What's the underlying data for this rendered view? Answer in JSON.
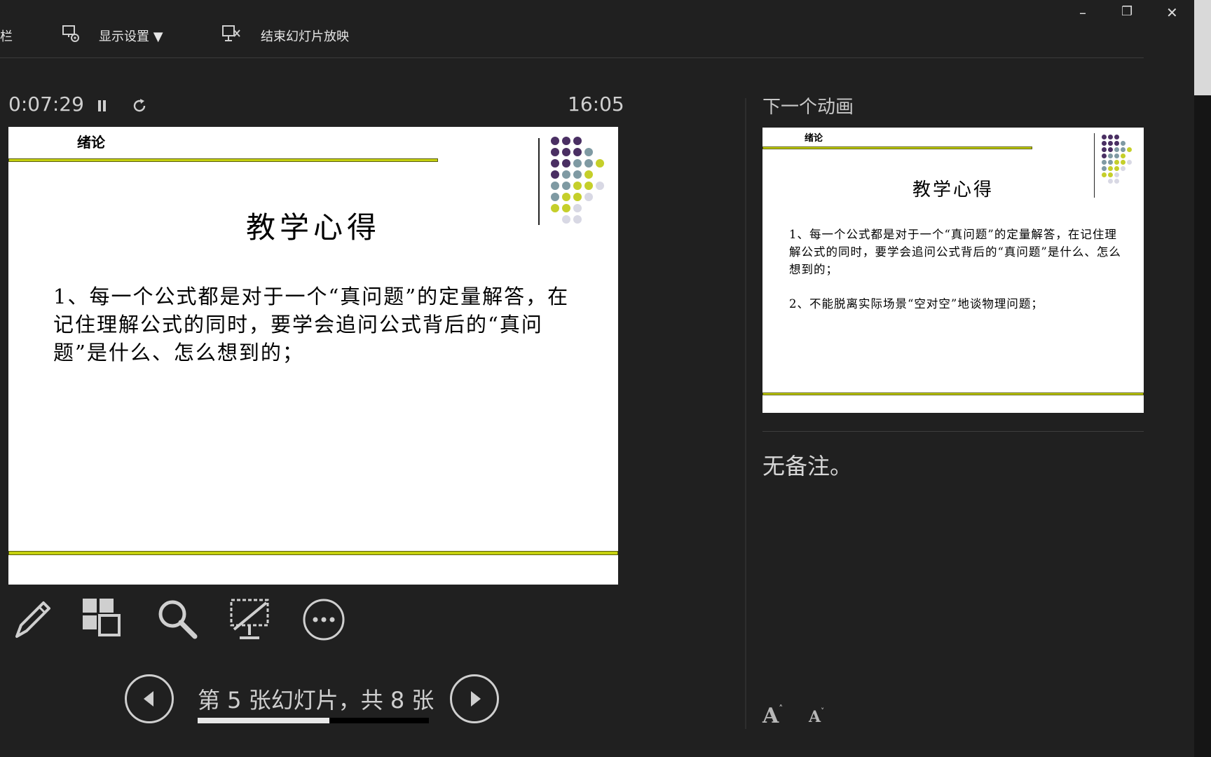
{
  "toolbar": {
    "partial_left_label": "栏",
    "display_settings_label": "显示设置 ▼",
    "end_show_label": "结束幻灯片放映"
  },
  "window_controls": {
    "minimize": "–",
    "restore": "❐",
    "close": "✕"
  },
  "presenter": {
    "elapsed_time": "0:07:29",
    "clock": "16:05",
    "next_animation_label": "下一个动画",
    "notes_text": "无备注。",
    "slide_counter": "第 5 张幻灯片，共 8 张",
    "progress_fraction": 0.57,
    "font_increase_label": "A",
    "font_decrease_label": "A"
  },
  "current_slide": {
    "section": "绪论",
    "title": "教学心得",
    "body": "1、每一个公式都是对于一个“真问题”的定量解答，在记住理解公式的同时，要学会追问公式背后的“真问题”是什么、怎么想到的；"
  },
  "next_slide": {
    "section": "绪论",
    "title": "教学心得",
    "body_point_1": "1、每一个公式都是对于一个“真问题”的定量解答，在记住理解公式的同时，要学会追问公式背后的“真问题”是什么、怎么想到的；",
    "body_point_2": "2、不能脱离实际场景“空对空”地谈物理问题；"
  },
  "colors": {
    "accent_line": "#c6d10e",
    "dot_purple": "#4a2f63",
    "dot_slate": "#7f9aa3",
    "dot_lime": "#c5cf2a",
    "dot_pale": "#d8d8e4"
  }
}
